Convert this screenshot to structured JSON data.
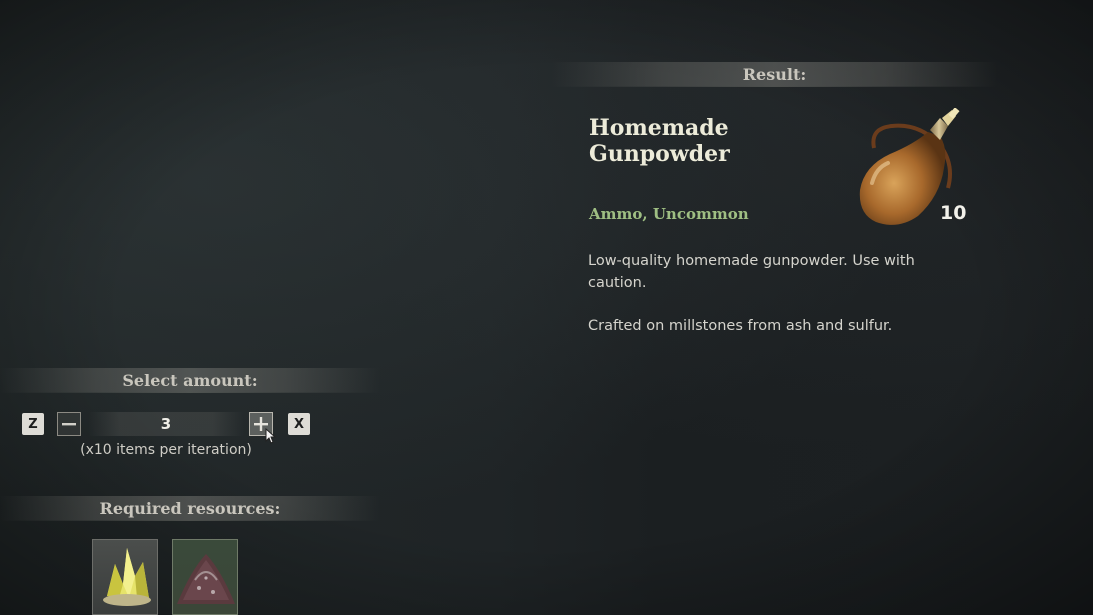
{
  "result_panel": {
    "header": "Result:",
    "item_name": "Homemade Gunpowder",
    "item_category": "Ammo, Uncommon",
    "quantity": "10",
    "icon": "gunpowder-flask-icon",
    "description": [
      "Low-quality homemade gunpowder. Use with caution.",
      "Crafted on millstones from ash and sulfur."
    ]
  },
  "amount_selector": {
    "header": "Select amount:",
    "decrease_key": "Z",
    "increase_key": "X",
    "value": "3",
    "hint": "(x10 items per iteration)"
  },
  "required_resources": {
    "header": "Required resources:",
    "items": [
      {
        "icon": "sulfur-crystal-icon"
      },
      {
        "icon": "ash-pile-icon"
      }
    ]
  },
  "colors": {
    "category_green": "#9fbf83",
    "title_text": "#ecebd9",
    "background": "#1d2124"
  }
}
